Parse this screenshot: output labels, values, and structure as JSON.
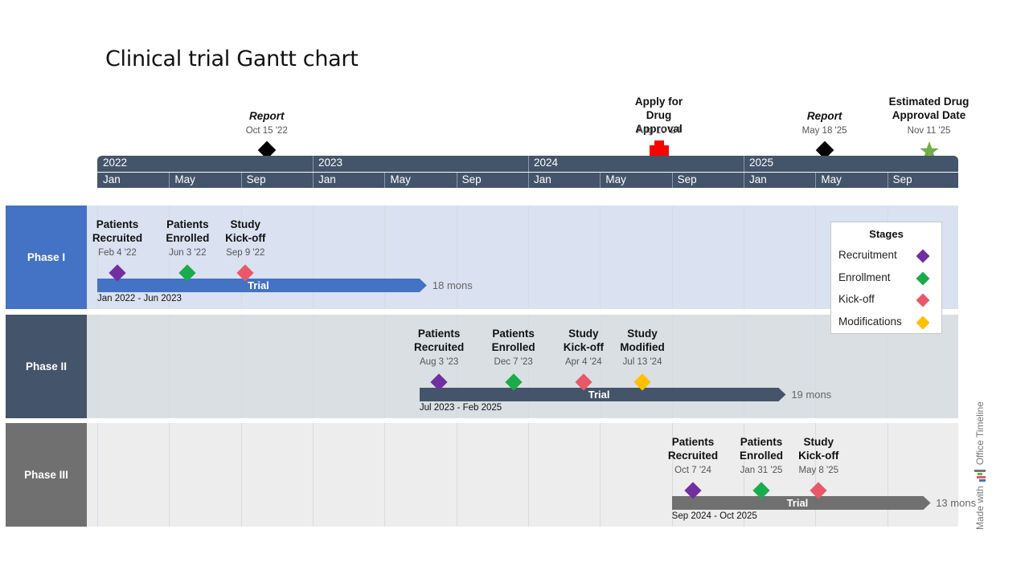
{
  "title": "Clinical trial Gantt chart",
  "chart_data": {
    "type": "gantt",
    "title": "Clinical trial Gantt chart",
    "time_range": {
      "start": "2022-01-01",
      "end": "2025-12-31"
    },
    "years": [
      "2022",
      "2023",
      "2024",
      "2025"
    ],
    "month_ticks": [
      "Jan",
      "May",
      "Sep"
    ],
    "top_milestones": [
      {
        "title": "Report",
        "italic": true,
        "date_label": "Oct 15 '22",
        "date": "2022-10-15",
        "shape": "diamond",
        "color": "#000000"
      },
      {
        "title": "Apply for Drug Approval",
        "italic": false,
        "date_label": "Aug 10 '24",
        "date": "2024-08-10",
        "shape": "cross",
        "color": "#ff0000"
      },
      {
        "title": "Report",
        "italic": true,
        "date_label": "May 18 '25",
        "date": "2025-05-18",
        "shape": "diamond",
        "color": "#000000"
      },
      {
        "title": "Estimated Drug Approval Date",
        "italic": false,
        "date_label": "Nov 11 '25",
        "date": "2025-11-11",
        "shape": "star",
        "color": "#70ad47"
      }
    ],
    "phases": [
      {
        "name": "Phase I",
        "label_color": "#4472c4",
        "band_color": "#dae1f0",
        "task": {
          "label": "Trial",
          "start": "2022-01-01",
          "end": "2023-06-30",
          "range_label": "Jan 2022 - Jun 2023",
          "duration_label": "18 mons",
          "color": "#4472c4"
        },
        "milestones": [
          {
            "title": "Patients Recruited",
            "date_label": "Feb 4 '22",
            "date": "2022-02-04",
            "stage": "Recruitment"
          },
          {
            "title": "Patients Enrolled",
            "date_label": "Jun 3 '22",
            "date": "2022-06-03",
            "stage": "Enrollment"
          },
          {
            "title": "Study Kick-off",
            "date_label": "Sep 9 '22",
            "date": "2022-09-09",
            "stage": "Kick-off"
          }
        ]
      },
      {
        "name": "Phase II",
        "label_color": "#44546a",
        "band_color": "#dadfe3",
        "task": {
          "label": "Trial",
          "start": "2023-07-01",
          "end": "2025-02-28",
          "range_label": "Jul 2023 - Feb 2025",
          "duration_label": "19 mons",
          "color": "#44546a"
        },
        "milestones": [
          {
            "title": "Patients Recruited",
            "date_label": "Aug 3 '23",
            "date": "2023-08-03",
            "stage": "Recruitment"
          },
          {
            "title": "Patients Enrolled",
            "date_label": "Dec 7 '23",
            "date": "2023-12-07",
            "stage": "Enrollment"
          },
          {
            "title": "Study Kick-off",
            "date_label": "Apr 4 '24",
            "date": "2024-04-04",
            "stage": "Kick-off"
          },
          {
            "title": "Study Modified",
            "date_label": "Jul 13 '24",
            "date": "2024-07-13",
            "stage": "Modifications"
          }
        ]
      },
      {
        "name": "Phase III",
        "label_color": "#707070",
        "band_color": "#ededed",
        "task": {
          "label": "Trial",
          "start": "2024-09-01",
          "end": "2025-10-31",
          "range_label": "Sep 2024 - Oct 2025",
          "duration_label": "13 mons",
          "color": "#707070"
        },
        "milestones": [
          {
            "title": "Patients Recruited",
            "date_label": "Oct 7 '24",
            "date": "2024-10-07",
            "stage": "Recruitment"
          },
          {
            "title": "Patients Enrolled",
            "date_label": "Jan 31 '25",
            "date": "2025-01-31",
            "stage": "Enrollment"
          },
          {
            "title": "Study Kick-off",
            "date_label": "May 8 '25",
            "date": "2025-05-08",
            "stage": "Kick-off"
          }
        ]
      }
    ],
    "legend": {
      "title": "Stages",
      "position": "right",
      "items": [
        {
          "label": "Recruitment",
          "color": "#7030a0"
        },
        {
          "label": "Enrollment",
          "color": "#1aab4b"
        },
        {
          "label": "Kick-off",
          "color": "#e9586a"
        },
        {
          "label": "Modifications",
          "color": "#ffc000"
        }
      ]
    }
  },
  "branding": {
    "prefix": "Made with",
    "name": "Office Timeline"
  }
}
